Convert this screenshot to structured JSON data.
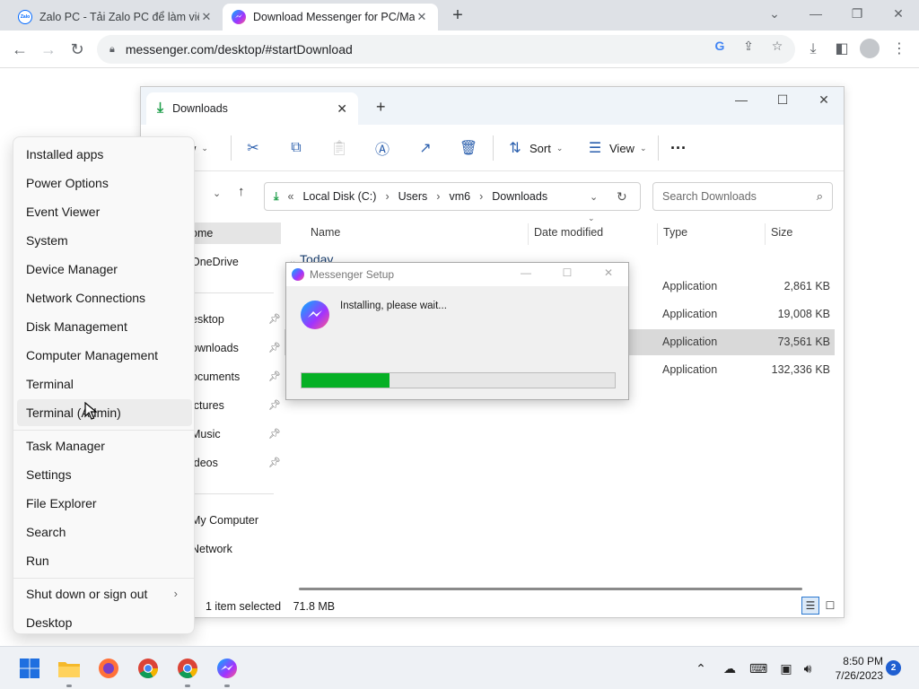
{
  "browser": {
    "tabs": [
      {
        "title": "Zalo PC - Tải Zalo PC để làm việc",
        "icon": "zalo-icon"
      },
      {
        "title": "Download Messenger for PC/Ma",
        "icon": "messenger-icon"
      }
    ],
    "url": "messenger.com/desktop/#startDownload"
  },
  "explorer": {
    "tab_title": "Downloads",
    "commands": {
      "new": "w",
      "sort": "Sort",
      "view": "View"
    },
    "breadcrumb": [
      "Local Disk (C:)",
      "Users",
      "vm6",
      "Downloads"
    ],
    "search_placeholder": "Search Downloads",
    "nav": [
      {
        "label": "ome",
        "selected": true,
        "pinned": false
      },
      {
        "label": "OneDrive",
        "selected": false,
        "pinned": false
      },
      {
        "label": "esktop",
        "selected": false,
        "pinned": true
      },
      {
        "label": "ownloads",
        "selected": false,
        "pinned": true
      },
      {
        "label": "ocuments",
        "selected": false,
        "pinned": true
      },
      {
        "label": "ictures",
        "selected": false,
        "pinned": true
      },
      {
        "label": "Music",
        "selected": false,
        "pinned": true
      },
      {
        "label": "ideos",
        "selected": false,
        "pinned": true
      },
      {
        "label": "My Computer",
        "selected": false,
        "pinned": false
      },
      {
        "label": "Network",
        "selected": false,
        "pinned": false
      }
    ],
    "columns": {
      "name": "Name",
      "date": "Date modified",
      "type": "Type",
      "size": "Size"
    },
    "group": "Today",
    "files": [
      {
        "type": "Application",
        "size": "2,861 KB",
        "selected": false
      },
      {
        "type": "Application",
        "size": "19,008 KB",
        "selected": false
      },
      {
        "type": "Application",
        "size": "73,561 KB",
        "selected": true
      },
      {
        "type": "Application",
        "size": "132,336 KB",
        "selected": false
      }
    ],
    "status": {
      "selected": "1 item selected",
      "size": "71.8 MB"
    }
  },
  "setup": {
    "title": "Messenger Setup",
    "message": "Installing, please wait...",
    "progress": 0.28
  },
  "winx_menu": {
    "groups": [
      [
        "Installed apps",
        "Power Options",
        "Event Viewer",
        "System",
        "Device Manager",
        "Network Connections",
        "Disk Management",
        "Computer Management",
        "Terminal",
        "Terminal (Admin)"
      ],
      [
        "Task Manager",
        "Settings",
        "File Explorer",
        "Search",
        "Run"
      ],
      [
        "Shut down or sign out",
        "Desktop"
      ]
    ],
    "hover_item": "Terminal (Admin)"
  },
  "taskbar": {
    "apps": [
      "start-icon",
      "file-explorer-icon",
      "firefox-icon",
      "chrome-icon",
      "chrome-icon",
      "messenger-icon"
    ],
    "time": "8:50 PM",
    "date": "7/26/2023",
    "notifications": "2"
  },
  "colors": {
    "progress_fill": "#06b025",
    "accent": "#2b5fad",
    "download_green": "#1e9e4a"
  }
}
